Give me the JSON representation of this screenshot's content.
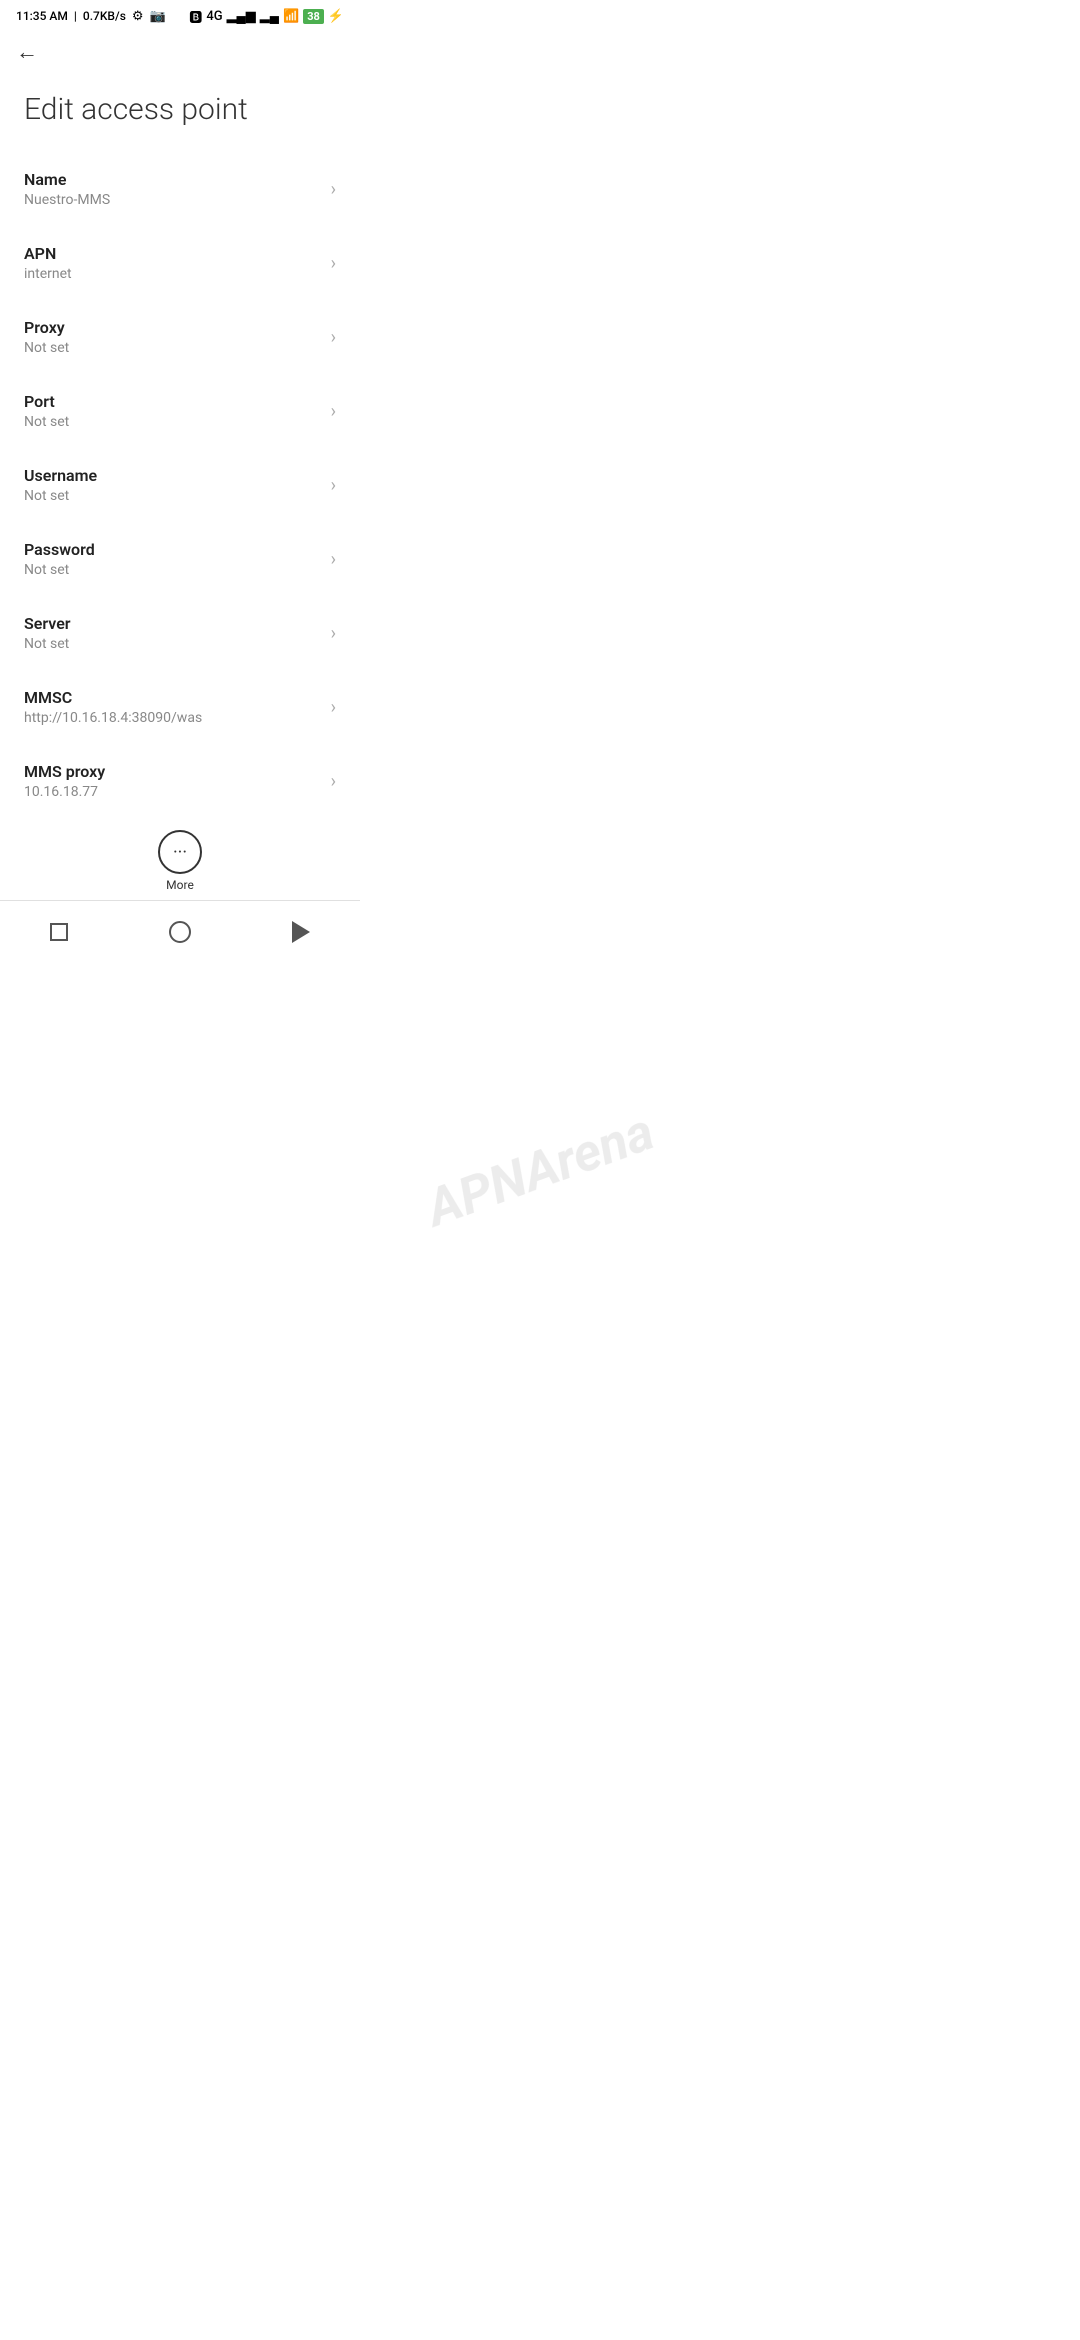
{
  "status_bar": {
    "time": "11:35 AM",
    "network_speed": "0.7KB/s",
    "battery_percent": "38"
  },
  "toolbar": {
    "back_label": "←"
  },
  "page": {
    "title": "Edit access point"
  },
  "settings_items": [
    {
      "label": "Name",
      "value": "Nuestro-MMS"
    },
    {
      "label": "APN",
      "value": "internet"
    },
    {
      "label": "Proxy",
      "value": "Not set"
    },
    {
      "label": "Port",
      "value": "Not set"
    },
    {
      "label": "Username",
      "value": "Not set"
    },
    {
      "label": "Password",
      "value": "Not set"
    },
    {
      "label": "Server",
      "value": "Not set"
    },
    {
      "label": "MMSC",
      "value": "http://10.16.18.4:38090/was"
    },
    {
      "label": "MMS proxy",
      "value": "10.16.18.77"
    }
  ],
  "bottom": {
    "more_label": "More",
    "more_dots": "···"
  },
  "nav_bar": {
    "square_label": "recent-apps",
    "circle_label": "home",
    "triangle_label": "back"
  }
}
